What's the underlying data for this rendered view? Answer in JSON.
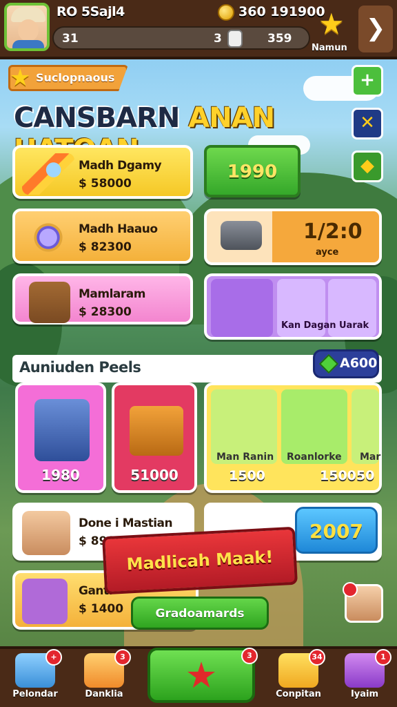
{
  "topbar": {
    "player_name": "RO 5Sajl4",
    "coins": "360 191900",
    "xp_left": "31",
    "xp_mid": "3",
    "xp_right": "359",
    "rank_label": "Namun"
  },
  "header": {
    "subtitle": "Suclopnaous",
    "title_part1": "CANSBARN",
    "title_part2": "ANAN HATQAN"
  },
  "shop_items": [
    {
      "name": "Madh Dgamy",
      "price": "$ 58000"
    },
    {
      "name": "Madh Haauo",
      "price": "$ 82300"
    },
    {
      "name": "Mamlaram",
      "price": "$ 28300"
    }
  ],
  "green_value": "1990",
  "timer": {
    "value": "1/2:0",
    "unit": "ayce"
  },
  "combo_labels": [
    "Kan Dagan",
    "Uarak"
  ],
  "section": {
    "title": "Auniuden Peels",
    "gems": "A600"
  },
  "packs": [
    {
      "price": "1980"
    },
    {
      "price": "51000"
    }
  ],
  "pack_group": [
    {
      "name": "Man Ranin",
      "price": "1500"
    },
    {
      "name": "Roanlorke",
      "price": "150050"
    },
    {
      "name": "Mar",
      "price": ""
    }
  ],
  "hero_card": {
    "name": "Done i Mastian",
    "price": "$ 8900"
  },
  "cta_value": "2007",
  "banner": "Madlicah Maak!",
  "tool_card": {
    "name": "Ganti",
    "price": "$ 1400"
  },
  "green_button": "Gradoamards",
  "nav": [
    {
      "label": "Pelondar",
      "badge": "+"
    },
    {
      "label": "Danklia",
      "badge": "3"
    },
    {
      "label": "Conpitan",
      "badge": "34"
    },
    {
      "label": "Iyaim",
      "badge": "1"
    }
  ],
  "nav_center_badge": "3"
}
